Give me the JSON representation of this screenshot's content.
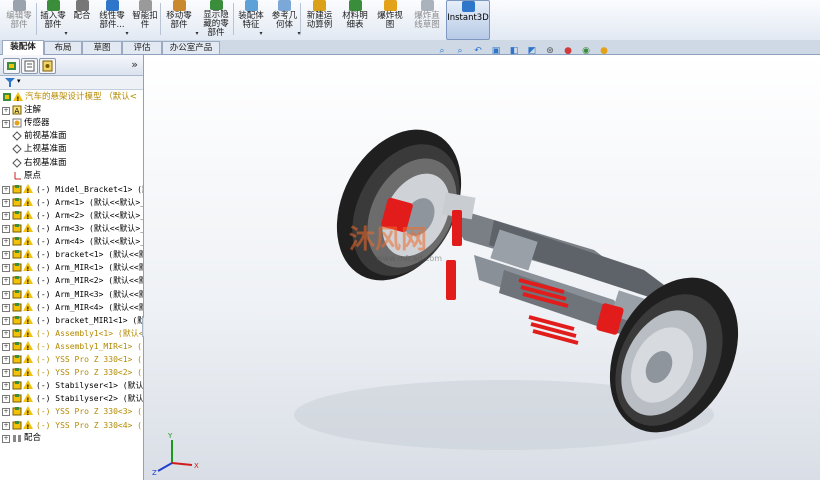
{
  "toolbar": {
    "buttons": [
      {
        "label": "编辑零\n部件",
        "icon": "edit-part-icon",
        "disabled": true
      },
      {
        "label": "插入零\n部件",
        "icon": "insert-component-icon",
        "disabled": false
      },
      {
        "label": "配合",
        "icon": "mate-icon",
        "disabled": false
      },
      {
        "label": "线性零\n部件...",
        "icon": "linear-pattern-icon",
        "disabled": false
      },
      {
        "label": "智能扣\n件",
        "icon": "smart-fastener-icon",
        "disabled": false
      },
      {
        "label": "移动零\n部件",
        "icon": "move-component-icon",
        "disabled": false
      },
      {
        "label": "显示隐\n藏的零\n部件",
        "icon": "show-hidden-icon",
        "disabled": false
      },
      {
        "label": "装配体\n特征",
        "icon": "assembly-feature-icon",
        "disabled": false
      },
      {
        "label": "参考几\n何体",
        "icon": "reference-geometry-icon",
        "disabled": false
      },
      {
        "label": "新建运\n动算例",
        "icon": "new-motion-study-icon",
        "disabled": false
      },
      {
        "label": "材料明\n细表",
        "icon": "bill-of-materials-icon",
        "disabled": false
      },
      {
        "label": "爆炸视\n图",
        "icon": "exploded-view-icon",
        "disabled": false
      },
      {
        "label": "爆炸直\n线草图",
        "icon": "explode-line-sketch-icon",
        "disabled": true
      }
    ],
    "instant3d": "Instant3D"
  },
  "tabs": [
    "装配体",
    "布局",
    "草图",
    "评估",
    "办公室产品"
  ],
  "active_tab": "装配体",
  "panel": {
    "collapse_glyph": "»",
    "tree": [
      {
        "label": "汽车的悬架设计模型 （默认<",
        "kind": "root"
      },
      {
        "label": "注解",
        "kind": "annotation"
      },
      {
        "label": "传感器",
        "kind": "sensor"
      },
      {
        "label": "前视基准面",
        "kind": "plane"
      },
      {
        "label": "上视基准面",
        "kind": "plane"
      },
      {
        "label": "右视基准面",
        "kind": "plane"
      },
      {
        "label": "原点",
        "kind": "origin"
      },
      {
        "label": "(-) Midel_Bracket<1> (默",
        "kind": "part-warn"
      },
      {
        "label": "(-) Arm<1> (默认<<默认>_显",
        "kind": "part"
      },
      {
        "label": "(-) Arm<2> (默认<<默认>_显",
        "kind": "part"
      },
      {
        "label": "(-) Arm<3> (默认<<默认>_显",
        "kind": "part"
      },
      {
        "label": "(-) Arm<4> (默认<<默认>_显",
        "kind": "part"
      },
      {
        "label": "(-) bracket<1> (默认<<默认",
        "kind": "part"
      },
      {
        "label": "(-) Arm_MIR<1> (默认<<默认",
        "kind": "part"
      },
      {
        "label": "(-) Arm_MIR<2> (默认<<默认",
        "kind": "part"
      },
      {
        "label": "(-) Arm_MIR<3> (默认<<默认",
        "kind": "part"
      },
      {
        "label": "(-) Arm_MIR<4> (默认<<默认",
        "kind": "part"
      },
      {
        "label": "(-) bracket_MIR1<1> (默认<",
        "kind": "part"
      },
      {
        "label": "(-) Assembly1<1> (默认<",
        "kind": "asm-warn"
      },
      {
        "label": "(-) Assembly1_MIR<1> (",
        "kind": "asm-warn"
      },
      {
        "label": "(-) YSS Pro Z 330<1> (",
        "kind": "asm-warn"
      },
      {
        "label": "(-) YSS Pro Z 330<2> (",
        "kind": "asm-warn"
      },
      {
        "label": "(-) Stabilyser<1> (默认<<",
        "kind": "part-warn"
      },
      {
        "label": "(-) Stabilyser<2> (默认<<",
        "kind": "part-warn"
      },
      {
        "label": "(-) YSS Pro Z 330<3> (",
        "kind": "asm-warn"
      },
      {
        "label": "(-) YSS Pro Z 330<4> (",
        "kind": "asm-warn"
      },
      {
        "label": "配合",
        "kind": "mates"
      }
    ]
  },
  "viewport": {
    "watermark_text": "沐风网",
    "watermark_url": "www.mfcad.com",
    "triad": {
      "x": "X",
      "y": "Y",
      "z": "Z"
    }
  },
  "colors": {
    "accent": "#7e98c0",
    "warning": "#f2c10a",
    "spring": "#e21b1b",
    "tire": "#222222"
  }
}
